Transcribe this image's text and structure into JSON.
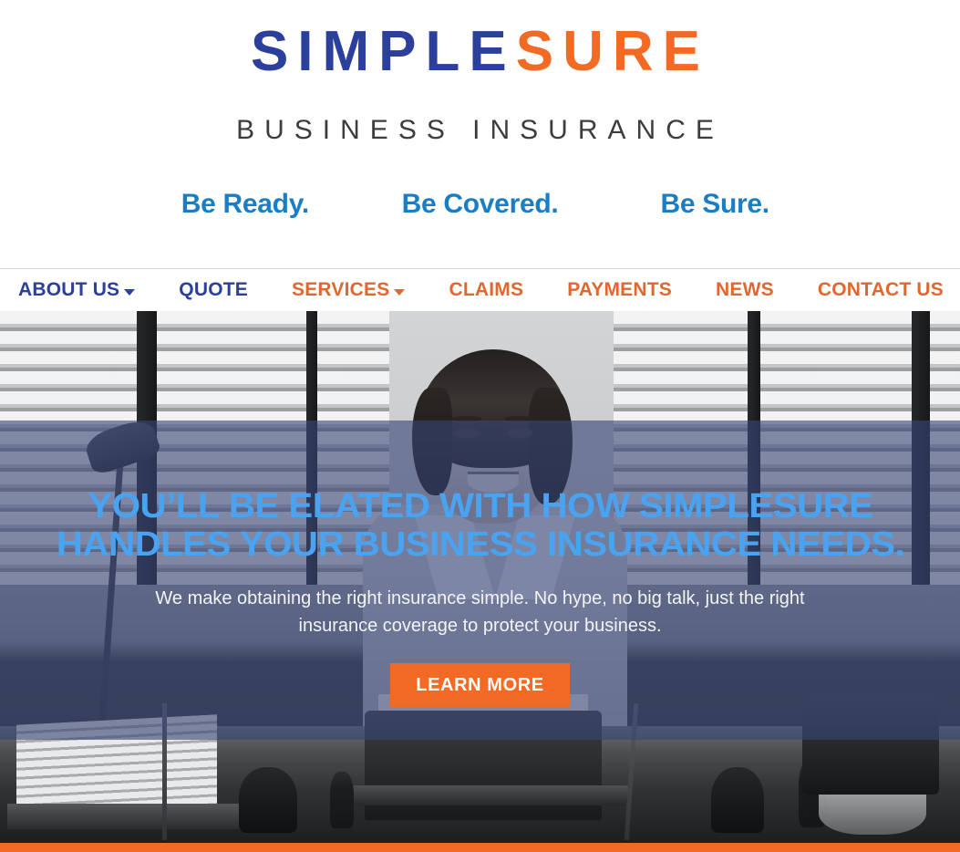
{
  "brand": {
    "logo_part1": "SIMPLE",
    "logo_part2": "SURE",
    "logo_subtitle": "BUSINESS INSURANCE",
    "color_blue": "#2b3f9d",
    "color_orange": "#f26a23",
    "color_tagline_blue": "#1a7ec4",
    "color_headline_blue": "#4aa3f0"
  },
  "taglines": [
    {
      "text": "Be Ready."
    },
    {
      "text": "Be Covered."
    },
    {
      "text": "Be Sure."
    }
  ],
  "nav": {
    "items": [
      {
        "label": "ABOUT US",
        "color": "blue",
        "has_dropdown": true
      },
      {
        "label": "QUOTE",
        "color": "blue",
        "has_dropdown": false
      },
      {
        "label": "SERVICES",
        "color": "orange",
        "has_dropdown": true
      },
      {
        "label": "CLAIMS",
        "color": "orange",
        "has_dropdown": false
      },
      {
        "label": "PAYMENTS",
        "color": "orange",
        "has_dropdown": false
      },
      {
        "label": "NEWS",
        "color": "orange",
        "has_dropdown": false
      },
      {
        "label": "CONTACT US",
        "color": "orange",
        "has_dropdown": false
      }
    ]
  },
  "hero": {
    "headline": "YOU’LL BE ELATED WITH HOW SIMPLESURE HANDLES YOUR BUSINESS INSURANCE NEEDS.",
    "subtext": "We make obtaining the right insurance simple.  No hype, no big talk, just the right insurance coverage to protect your business.",
    "cta_label": "LEARN MORE",
    "overlay_color": "rgba(56, 70, 118, 0.62)",
    "image_description": "black and white photo of a smiling woman at an office desk with a typewriter and window blinds"
  }
}
